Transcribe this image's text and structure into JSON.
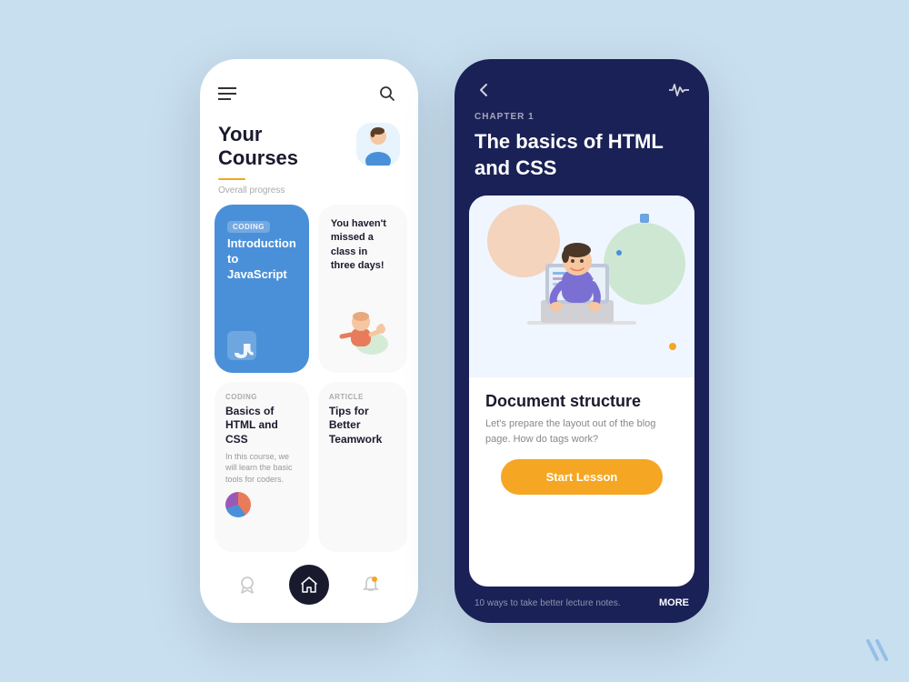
{
  "bg_color": "#c8dff0",
  "left_phone": {
    "title_line1": "Your",
    "title_line2": "Courses",
    "progress_label": "Overall progress",
    "card_coding": {
      "tag": "CODING",
      "title": "Introduction to JavaScript"
    },
    "card_streak": {
      "text": "You haven't missed a class in three days!"
    },
    "card_html": {
      "tag": "CODING",
      "title": "Basics of HTML and CSS",
      "desc": "In this course, we will learn the basic tools for coders."
    },
    "card_article": {
      "tag": "ARTICLE",
      "title": "Tips for Better Teamwork"
    },
    "nav": {
      "icon1": "🏆",
      "icon2": "⬡",
      "icon3": "🔔"
    }
  },
  "right_phone": {
    "chapter_label": "CHAPTER 1",
    "title": "The basics of HTML and CSS",
    "lesson": {
      "heading": "Document structure",
      "desc": "Let's prepare the layout out of the blog page. How do tags work?",
      "button_label": "Start Lesson"
    },
    "bottom_hint": "10 ways to take better lecture notes.",
    "more_label": "MORE"
  }
}
